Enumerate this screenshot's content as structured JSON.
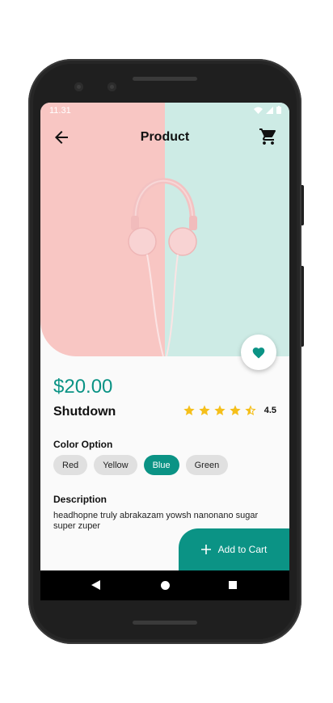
{
  "status_bar": {
    "time": "11.31"
  },
  "appbar": {
    "title": "Product"
  },
  "product": {
    "price": "$20.00",
    "name": "Shutdown",
    "rating": "4.5",
    "rating_value": 4.5
  },
  "colors": {
    "label": "Color Option",
    "options": [
      "Red",
      "Yellow",
      "Blue",
      "Green"
    ],
    "selected": "Blue"
  },
  "description": {
    "label": "Description",
    "text": "headhopne truly abrakazam yowsh nanonano sugar super zuper"
  },
  "cta": {
    "add_to_cart": "Add to Cart"
  },
  "theme": {
    "accent": "#0b9385",
    "star": "#f5bf1a",
    "hero_pink": "#f8c6c3",
    "hero_mint": "#cdebe5"
  }
}
